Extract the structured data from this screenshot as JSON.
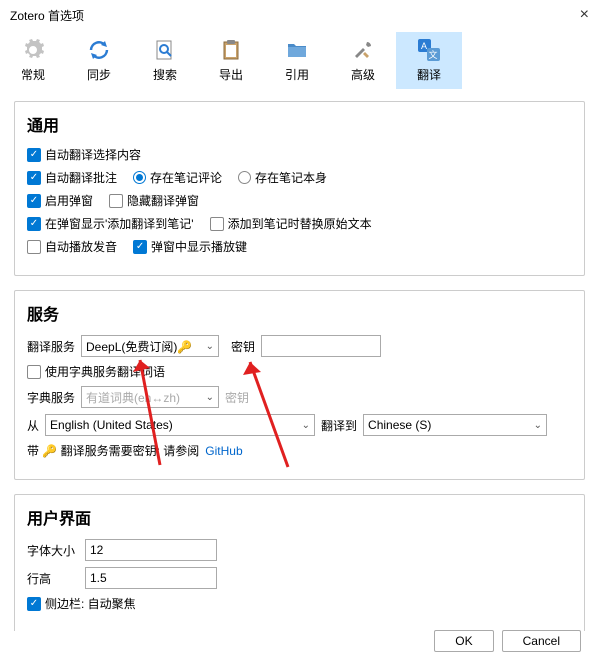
{
  "window": {
    "title": "Zotero 首选项"
  },
  "tabs": {
    "general": "常规",
    "sync": "同步",
    "search": "搜索",
    "export": "导出",
    "cite": "引用",
    "advanced": "高级",
    "translate": "翻译"
  },
  "sections": {
    "general": {
      "title": "通用",
      "auto_translate_selection": "自动翻译选择内容",
      "auto_translate_annotation": "自动翻译批注",
      "save_in_note_comment": "存在笔记评论",
      "save_in_note_body": "存在笔记本身",
      "enable_popup": "启用弹窗",
      "hide_translate_popup": "隐藏翻译弹窗",
      "show_add_to_note_in_popup": "在弹窗显示'添加翻译到笔记'",
      "replace_original_when_add": "添加到笔记时替换原始文本",
      "auto_play_audio": "自动播放发音",
      "show_play_button_in_popup": "弹窗中显示播放键"
    },
    "services": {
      "title": "服务",
      "translate_service_label": "翻译服务",
      "translate_service_value": "DeepL(免费订阅)🔑",
      "secret_label": "密钥",
      "secret_value": "",
      "use_dict_service": "使用字典服务翻译词语",
      "dict_service_label": "字典服务",
      "dict_service_value": "有道词典(en↔zh)",
      "dict_secret_label": "密钥",
      "from_label": "从",
      "from_value": "English (United States)",
      "to_label": "翻译到",
      "to_value": "Chinese (S)",
      "note_prefix": "带 🔑 翻译服务需要密钥; 请参阅",
      "note_link": "GitHub"
    },
    "ui": {
      "title": "用户界面",
      "font_size_label": "字体大小",
      "font_size_value": "12",
      "line_height_label": "行高",
      "line_height_value": "1.5",
      "sidebar_autofocus": "侧边栏: 自动聚焦"
    }
  },
  "footer": {
    "ok": "OK",
    "cancel": "Cancel"
  }
}
